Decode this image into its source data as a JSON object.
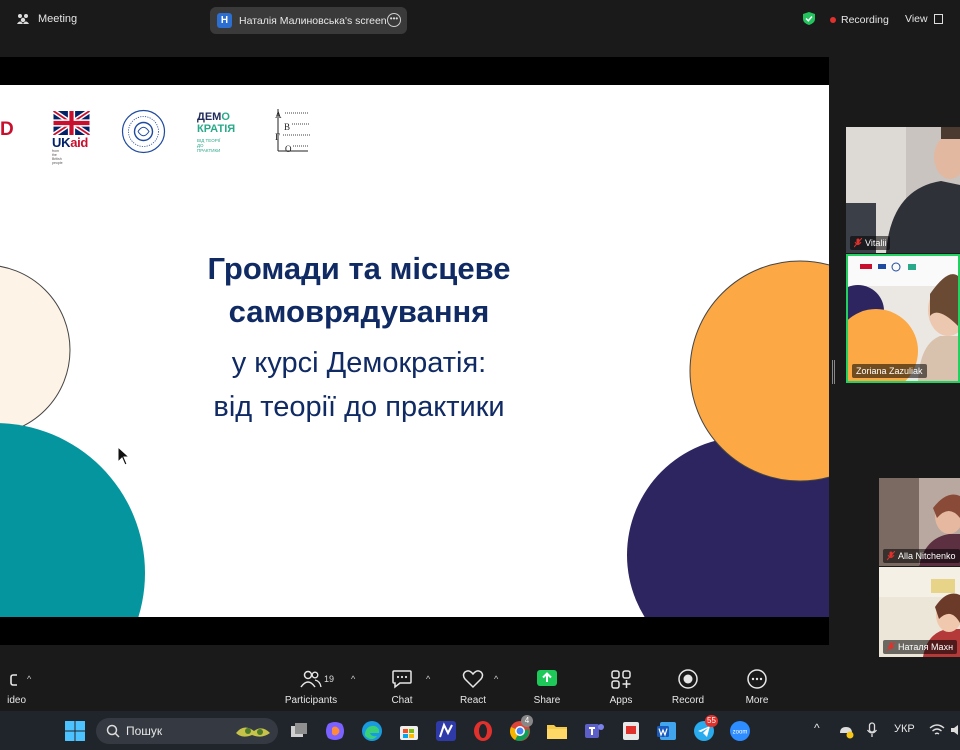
{
  "topbar": {
    "meeting_label": "Meeting",
    "screen_initial": "Н",
    "screen_label": "Наталія Малиновська's screen",
    "recording_label": "Recording",
    "view_label": "View"
  },
  "slide": {
    "logos": {
      "usaid_fragment": "D",
      "ukaid_uk": "UK",
      "ukaid_aid": "aid",
      "ukaid_small": "from the British people",
      "demo_line1_a": "ДЕМ",
      "demo_line1_b": "О",
      "demo_line2": "КРАТІЯ",
      "demo_sub1": "ВІД ТЕОРІЇ",
      "demo_sub2": "ДО ПРАКТИКИ"
    },
    "title_line1": "Громади та місцеве",
    "title_line2": "самоврядування",
    "subtitle_line1": "у курсі Демократія:",
    "subtitle_line2": "від теорії до практики"
  },
  "participants": [
    {
      "name": "Vitalii"
    },
    {
      "name": "Zoriana Zazuliak"
    },
    {
      "name": "Alla Nitchenko"
    },
    {
      "name": "Наталя Махн"
    }
  ],
  "toolbar": {
    "video_label": "ideo",
    "participants_label": "Participants",
    "participants_count": "19",
    "chat_label": "Chat",
    "react_label": "React",
    "share_label": "Share",
    "apps_label": "Apps",
    "record_label": "Record",
    "more_label": "More"
  },
  "taskbar": {
    "search_placeholder": "Пошук",
    "chrome_badge": "4",
    "telegram_badge": "55",
    "lang": "УКР"
  },
  "colors": {
    "slide_navy": "#102a64",
    "orange": "#fba845",
    "teal": "#04959f",
    "dark_purple": "#2c2560",
    "cream": "#fdf3e6",
    "share_green": "#1ec95a",
    "active_speaker": "#23d160"
  }
}
